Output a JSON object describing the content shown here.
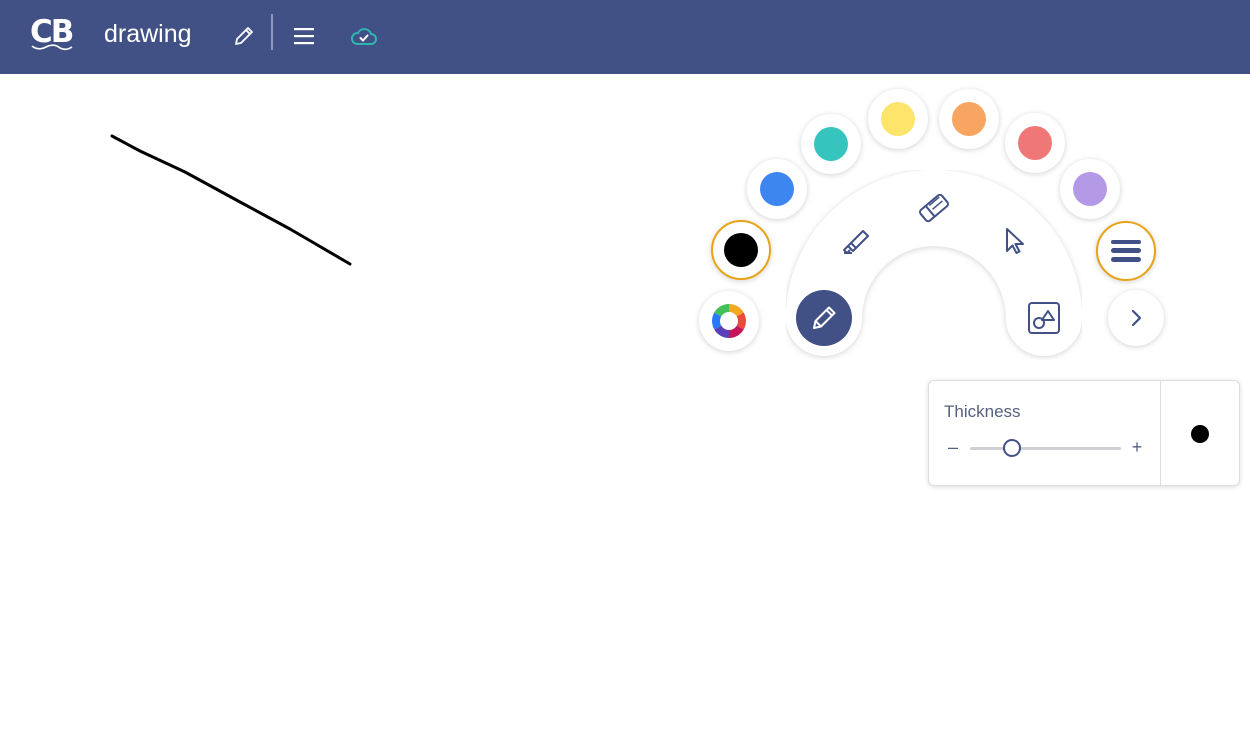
{
  "header": {
    "logo_text": "CB",
    "doc_title": "drawing",
    "icons": [
      "pencil-edit-icon",
      "hamburger-menu-icon",
      "cloud-saved-icon"
    ],
    "bg_color": "#415186",
    "cloud_color": "#2fb5b0"
  },
  "palette": {
    "colors": [
      {
        "name": "black",
        "hex": "#000000",
        "selected": true
      },
      {
        "name": "blue",
        "hex": "#3d86f0",
        "selected": false
      },
      {
        "name": "teal",
        "hex": "#35c4be",
        "selected": false
      },
      {
        "name": "yellow",
        "hex": "#fde46a",
        "selected": false
      },
      {
        "name": "orange",
        "hex": "#f7a560",
        "selected": false
      },
      {
        "name": "red",
        "hex": "#f07777",
        "selected": false
      },
      {
        "name": "purple",
        "hex": "#b499e6",
        "selected": false
      }
    ],
    "selected_color": "#000000",
    "selection_ring_color": "#e8a317"
  },
  "tools": {
    "items": [
      "pen",
      "highlighter",
      "eraser",
      "select",
      "shapes"
    ],
    "active": "pen",
    "extra": [
      "color-wheel-icon",
      "stroke-style-icon",
      "chevron-right-icon"
    ]
  },
  "thickness": {
    "label": "Thickness",
    "minus": "–",
    "plus": "+",
    "value_fraction": 0.28,
    "preview_color": "#000000"
  }
}
